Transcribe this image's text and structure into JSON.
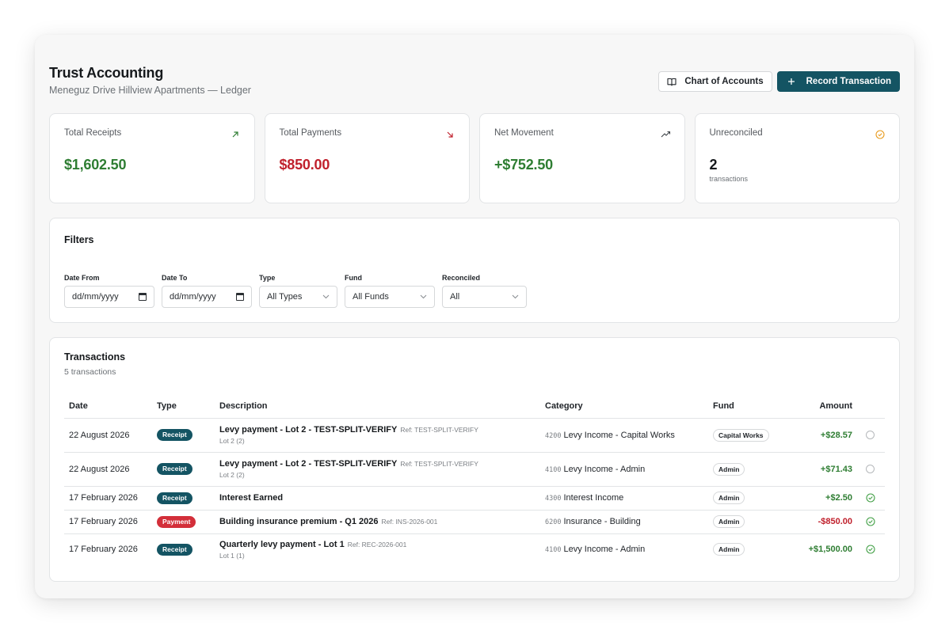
{
  "header": {
    "title": "Trust Accounting",
    "subtitle": "Meneguz Drive Hillview Apartments — Ledger",
    "chart_of_accounts_label": "Chart of Accounts",
    "record_transaction_label": "Record Transaction"
  },
  "stats": [
    {
      "label": "Total Receipts",
      "value": "$1,602.50",
      "icon": "arrow-up-right-icon",
      "color": "#2e7d32"
    },
    {
      "label": "Total Payments",
      "value": "$850.00",
      "icon": "arrow-down-right-icon",
      "color": "#c0202c"
    },
    {
      "label": "Net Movement",
      "value": "+$752.50",
      "icon": "trending-up-icon",
      "color": "#2e7d32"
    },
    {
      "label": "Unreconciled",
      "value": "2",
      "sub": "transactions",
      "icon": "clock-check-icon",
      "color": "#e89a1c"
    }
  ],
  "filters": {
    "title": "Filters",
    "date_from": {
      "label": "Date From",
      "value": "dd/mm/yyyy"
    },
    "date_to": {
      "label": "Date To",
      "value": "dd/mm/yyyy"
    },
    "type": {
      "label": "Type",
      "value": "All Types"
    },
    "fund": {
      "label": "Fund",
      "value": "All Funds"
    },
    "reconciled": {
      "label": "Reconciled",
      "value": "All"
    }
  },
  "transactions": {
    "title": "Transactions",
    "count_text": "5 transactions",
    "columns": [
      "Date",
      "Type",
      "Description",
      "Category",
      "Fund",
      "Amount"
    ],
    "rows": [
      {
        "date": "22 August 2026",
        "type": "Receipt",
        "description": "Levy payment - Lot 2 - TEST-SPLIT-VERIFY",
        "ref": "Ref: TEST-SPLIT-VERIFY",
        "sub": "Lot 2 (2)",
        "code": "4200",
        "category": "Levy Income - Capital Works",
        "fund": "Capital Works",
        "amount": "+$28.57",
        "reconciled": false
      },
      {
        "date": "22 August 2026",
        "type": "Receipt",
        "description": "Levy payment - Lot 2 - TEST-SPLIT-VERIFY",
        "ref": "Ref: TEST-SPLIT-VERIFY",
        "sub": "Lot 2 (2)",
        "code": "4100",
        "category": "Levy Income - Admin",
        "fund": "Admin",
        "amount": "+$71.43",
        "reconciled": false
      },
      {
        "date": "17 February 2026",
        "type": "Receipt",
        "description": "Interest Earned",
        "ref": "",
        "sub": "",
        "code": "4300",
        "category": "Interest Income",
        "fund": "Admin",
        "amount": "+$2.50",
        "reconciled": true
      },
      {
        "date": "17 February 2026",
        "type": "Payment",
        "description": "Building insurance premium - Q1 2026",
        "ref": "Ref: INS-2026-001",
        "sub": "",
        "code": "6200",
        "category": "Insurance - Building",
        "fund": "Admin",
        "amount": "-$850.00",
        "reconciled": true
      },
      {
        "date": "17 February 2026",
        "type": "Receipt",
        "description": "Quarterly levy payment - Lot 1",
        "ref": "Ref: REC-2026-001",
        "sub": "Lot 1 (1)",
        "code": "4100",
        "category": "Levy Income - Admin",
        "fund": "Admin",
        "amount": "+$1,500.00",
        "reconciled": true
      }
    ]
  },
  "colors": {
    "brand": "#145463",
    "positive": "#2e7d32",
    "negative": "#c0202c",
    "reconciled": "#43a047"
  }
}
